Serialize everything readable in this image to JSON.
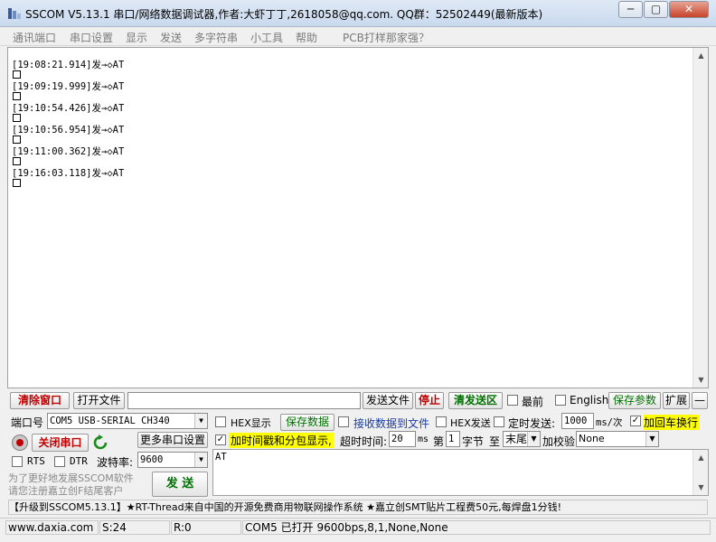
{
  "window": {
    "title": "SSCOM V5.13.1 串口/网络数据调试器,作者:大虾丁丁,2618058@qq.com. QQ群：52502449(最新版本)",
    "minimize_glyph": "─",
    "restore_glyph": "▢",
    "close_glyph": "✕"
  },
  "menu": {
    "items": [
      "通讯端口",
      "串口设置",
      "显示",
      "发送",
      "多字符串",
      "小工具",
      "帮助",
      "PCB打样那家强？"
    ]
  },
  "receive": {
    "lines": [
      "[19:08:21.914]发→◇AT",
      "[19:09:19.999]发→◇AT",
      "[19:10:54.426]发→◇AT",
      "[19:10:56.954]发→◇AT",
      "[19:11:00.362]发→◇AT",
      "[19:16:03.118]发→◇AT"
    ]
  },
  "toolbar": {
    "clear_window": "清除窗口",
    "open_file": "打开文件",
    "file_path": "",
    "send_file": "发送文件",
    "stop": "停止",
    "clear_send": "清发送区",
    "topmost": "最前",
    "english": "English",
    "save_params": "保存参数",
    "expand": "扩展",
    "collapse": "—"
  },
  "port": {
    "port_label": "端口号",
    "port_value": "COM5 USB-SERIAL CH340",
    "close_port": "关闭串口",
    "more_settings": "更多串口设置",
    "rts": "RTS",
    "dtr": "DTR",
    "baud_label": "波特率:",
    "baud_value": "9600"
  },
  "options": {
    "hex_display": "HEX显示",
    "save_data": "保存数据",
    "recv_to_file": "接收数据到文件",
    "hex_send": "HEX发送",
    "timed_send": "定时发送:",
    "interval": "1000",
    "interval_unit": "ms/次",
    "add_crlf": "加回车换行",
    "add_timestamp": "加时间戳和分包显示,",
    "timeout_label": "超时时间:",
    "timeout_value": "20",
    "ms": "ms",
    "first": "第",
    "byte_index": "1",
    "byte_label": "字节",
    "to": "至",
    "end_value": "末尾",
    "checksum_label": "加校验",
    "checksum_value": "None"
  },
  "send": {
    "text": "AT",
    "send_button": "发 送"
  },
  "promo": {
    "line1": "为了更好地发展SSCOM软件",
    "line2": "请您注册嘉立创F结尾客户",
    "banner": "【升级到SSCOM5.13.1】★RT-Thread来自中国的开源免费商用物联网操作系统   ★嘉立创SMT贴片工程费50元,每焊盘1分钱!"
  },
  "status": {
    "website": "www.daxia.com",
    "sent": "S:24",
    "received": "R:0",
    "port_state": "COM5 已打开  9600bps,8,1,None,None"
  },
  "colors": {
    "highlight_yellow": "#ffff00",
    "red_text": "#c00000",
    "green_text": "#007000"
  }
}
